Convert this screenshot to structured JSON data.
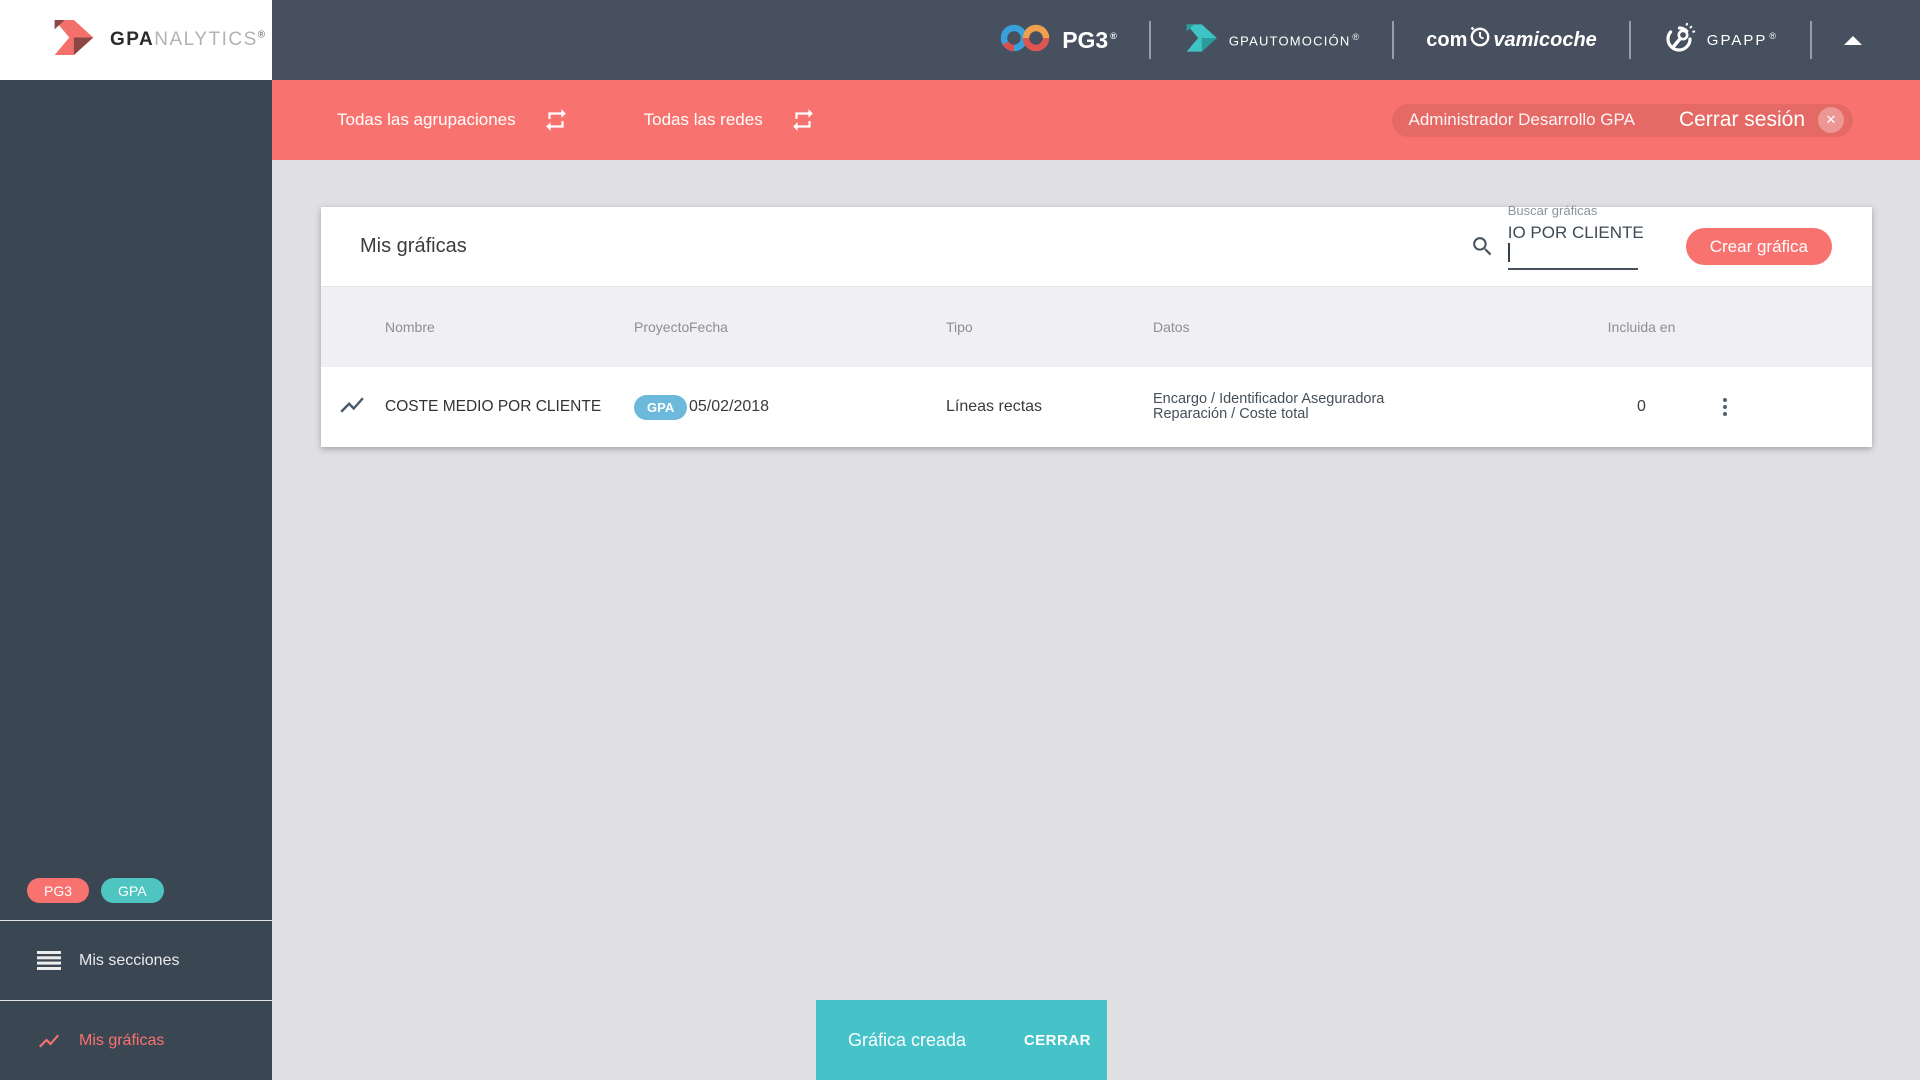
{
  "sidebar": {
    "logo": {
      "bold": "GPA",
      "light": "NALYTICS",
      "registered": "®"
    },
    "badges": [
      {
        "label": "PG3"
      },
      {
        "label": "GPA"
      }
    ],
    "items": [
      {
        "label": "Mis secciones"
      },
      {
        "label": "Mis gráficas"
      }
    ]
  },
  "header": {
    "pg3": {
      "text": "PG3",
      "registered": "®"
    },
    "gpautomocion": {
      "text": "GPAUTOMOCIÓN",
      "registered": "®"
    },
    "comprovamicoche": {
      "left": "com",
      "right": "vamicoche"
    },
    "gpapp": {
      "text": "GPAPP",
      "registered": "®"
    }
  },
  "filter_bar": {
    "groupings_label": "Todas las agrupaciones",
    "networks_label": "Todas las redes",
    "user_name": "Administrador Desarrollo GPA",
    "logout_label": "Cerrar sesión",
    "logout_close": "✕"
  },
  "card": {
    "title": "Mis gráficas",
    "search": {
      "label": "Buscar gráficas",
      "value": "IO POR CLIENTE"
    },
    "create_button_label": "Crear gráfica",
    "table": {
      "columns": [
        "Nombre",
        "Proyecto",
        "Fecha",
        "Tipo",
        "Datos",
        "Incluida en"
      ],
      "rows": [
        {
          "name": "COSTE MEDIO POR CLIENTE",
          "project_badge": "GPA",
          "date": "05/02/2018",
          "type": "Líneas rectas",
          "data_line1": "Encargo / Identificador Aseguradora",
          "data_line2": "Reparación / Coste total",
          "included_in": "0"
        }
      ]
    }
  },
  "snackbar": {
    "message": "Gráfica creada",
    "action_label": "CERRAR"
  },
  "colors": {
    "coral": "#F8736F",
    "teal_snackbar": "#45C3C9",
    "teal_badge": "#4EC5C1",
    "blue_badge": "#6CB9DB",
    "header_dark": "#47505E",
    "sidebar_dark": "#3B4653",
    "page_bg": "#E0E0E3",
    "table_header_bg": "#F0F0F2"
  }
}
